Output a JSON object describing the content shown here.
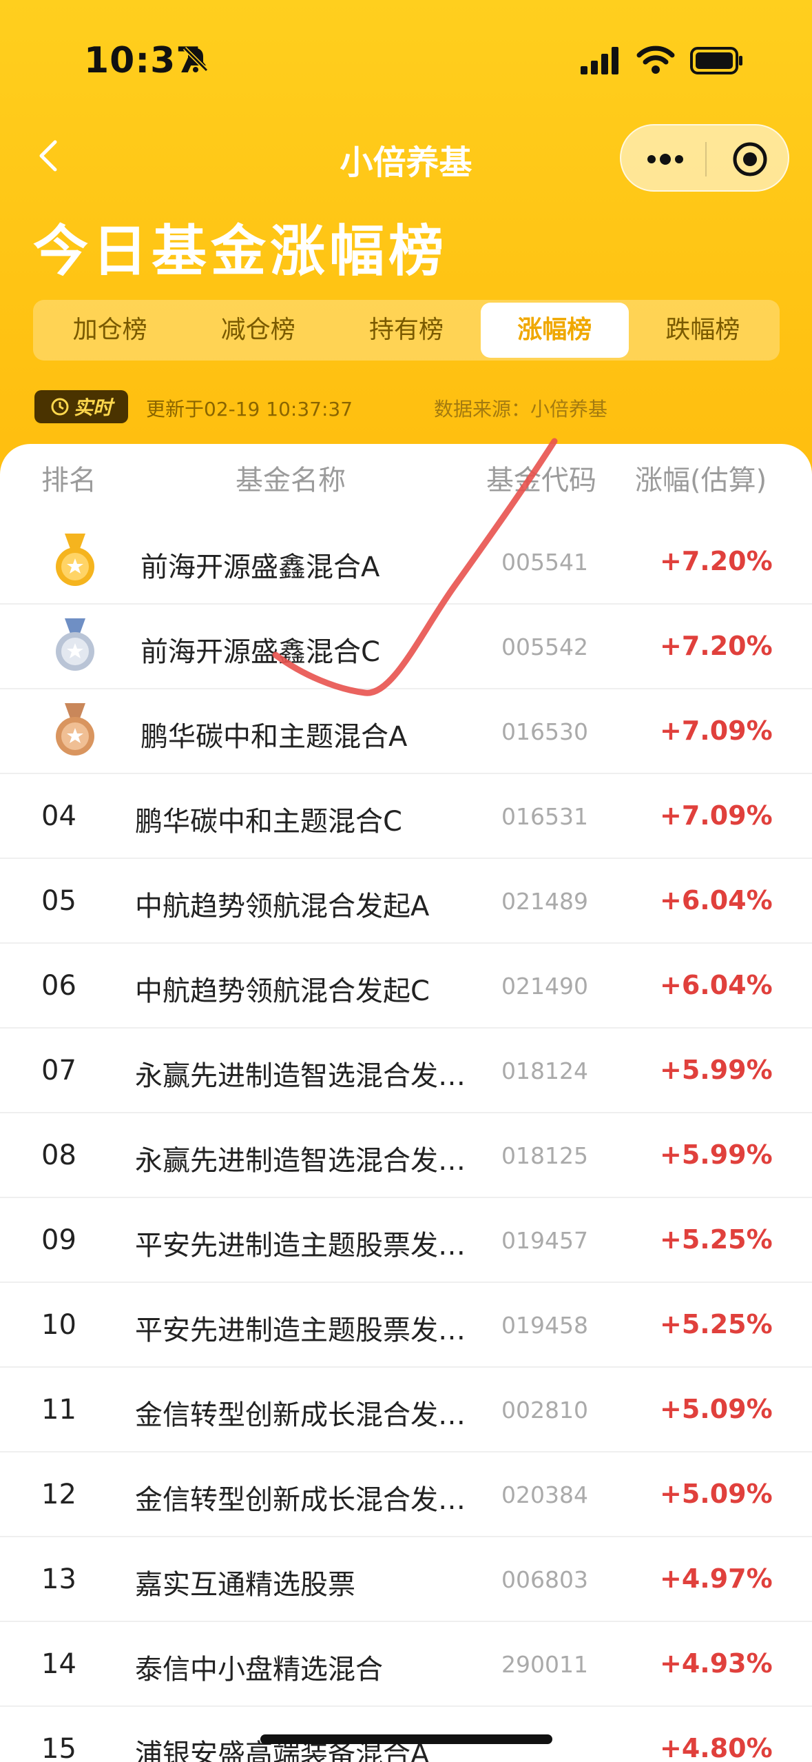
{
  "status": {
    "time": "10:37"
  },
  "nav": {
    "title": "小倍养基"
  },
  "page_title": "今日基金涨幅榜",
  "tabs": [
    {
      "label": "加仓榜",
      "active": false
    },
    {
      "label": "减仓榜",
      "active": false
    },
    {
      "label": "持有榜",
      "active": false
    },
    {
      "label": "涨幅榜",
      "active": true
    },
    {
      "label": "跌幅榜",
      "active": false
    }
  ],
  "realtime": {
    "badge": "实时",
    "updated": "更新于02-19 10:37:37",
    "source": "数据来源：小倍养基"
  },
  "table": {
    "headers": {
      "rank": "排名",
      "name": "基金名称",
      "code": "基金代码",
      "change": "涨幅(估算)"
    },
    "rows": [
      {
        "rank": "",
        "medal": "gold",
        "name": "前海开源盛鑫混合A",
        "code": "005541",
        "change": "+7.20%"
      },
      {
        "rank": "",
        "medal": "silver",
        "name": "前海开源盛鑫混合C",
        "code": "005542",
        "change": "+7.20%"
      },
      {
        "rank": "",
        "medal": "bronze",
        "name": "鹏华碳中和主题混合A",
        "code": "016530",
        "change": "+7.09%"
      },
      {
        "rank": "04",
        "name": "鹏华碳中和主题混合C",
        "code": "016531",
        "change": "+7.09%"
      },
      {
        "rank": "05",
        "name": "中航趋势领航混合发起A",
        "code": "021489",
        "change": "+6.04%"
      },
      {
        "rank": "06",
        "name": "中航趋势领航混合发起C",
        "code": "021490",
        "change": "+6.04%"
      },
      {
        "rank": "07",
        "name": "永赢先进制造智选混合发…",
        "code": "018124",
        "change": "+5.99%"
      },
      {
        "rank": "08",
        "name": "永赢先进制造智选混合发…",
        "code": "018125",
        "change": "+5.99%"
      },
      {
        "rank": "09",
        "name": "平安先进制造主题股票发…",
        "code": "019457",
        "change": "+5.25%"
      },
      {
        "rank": "10",
        "name": "平安先进制造主题股票发…",
        "code": "019458",
        "change": "+5.25%"
      },
      {
        "rank": "11",
        "name": "金信转型创新成长混合发…",
        "code": "002810",
        "change": "+5.09%"
      },
      {
        "rank": "12",
        "name": "金信转型创新成长混合发…",
        "code": "020384",
        "change": "+5.09%"
      },
      {
        "rank": "13",
        "name": "嘉实互通精选股票",
        "code": "006803",
        "change": "+4.97%"
      },
      {
        "rank": "14",
        "name": "泰信中小盘精选混合",
        "code": "290011",
        "change": "+4.93%"
      },
      {
        "rank": "15",
        "name": "浦银安盛高端装备混合A",
        "code": "",
        "change": "+4.80%"
      }
    ]
  },
  "colors": {
    "brand": "#ffc414",
    "positive": "#e0403c",
    "active_tab": "#f0a800"
  }
}
